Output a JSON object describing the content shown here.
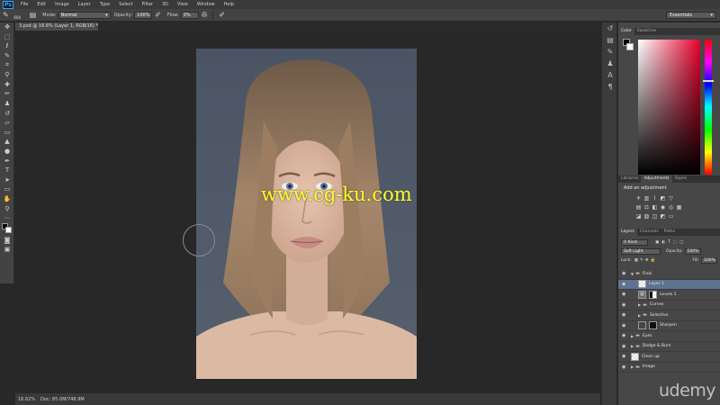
{
  "app": {
    "logo": "Ps"
  },
  "menu": [
    "File",
    "Edit",
    "Image",
    "Layer",
    "Type",
    "Select",
    "Filter",
    "3D",
    "View",
    "Window",
    "Help"
  ],
  "options": {
    "brush_size": "600",
    "mode_label": "Mode:",
    "mode_value": "Normal",
    "opacity_label": "Opacity:",
    "opacity_value": "100%",
    "flow_label": "Flow:",
    "flow_value": "3%",
    "workspace": "Essentials"
  },
  "document": {
    "tab_title": "3.psd @ 16.6% (Layer 1, RGB/16) *",
    "watermark": "www.cg-ku.com"
  },
  "status": {
    "zoom": "16.62%",
    "doc": "Doc: 85.0M/748.9M"
  },
  "color_panel": {
    "tabs": [
      "Color",
      "Swatches"
    ]
  },
  "adjustments_panel": {
    "tabs": [
      "Libraries",
      "Adjustments",
      "Styles"
    ],
    "title": "Add an adjustment"
  },
  "layers_panel": {
    "tabs": [
      "Layers",
      "Channels",
      "Paths"
    ],
    "kind_label": "Kind",
    "blend_mode": "Soft Light",
    "opacity_label": "Opacity:",
    "opacity_value": "100%",
    "lock_label": "Lock:",
    "fill_label": "Fill:",
    "fill_value": "100%",
    "layers": [
      {
        "name": "Final",
        "kind": "folder",
        "indent": 0,
        "open": true
      },
      {
        "name": "Layer 1",
        "kind": "pixel",
        "indent": 1,
        "selected": true
      },
      {
        "name": "Levels 1",
        "kind": "adjustment",
        "indent": 1
      },
      {
        "name": "Curves",
        "kind": "folder",
        "indent": 1
      },
      {
        "name": "Selective",
        "kind": "folder",
        "indent": 1
      },
      {
        "name": "Sharpen",
        "kind": "masked",
        "indent": 1
      },
      {
        "name": "Eyes",
        "kind": "folder",
        "indent": 0
      },
      {
        "name": "Dodge & Burn",
        "kind": "folder",
        "indent": 0
      },
      {
        "name": "Clean up",
        "kind": "pixel",
        "indent": 0
      },
      {
        "name": "Image",
        "kind": "folder",
        "indent": 0
      }
    ]
  },
  "branding": {
    "udemy": "udemy"
  }
}
